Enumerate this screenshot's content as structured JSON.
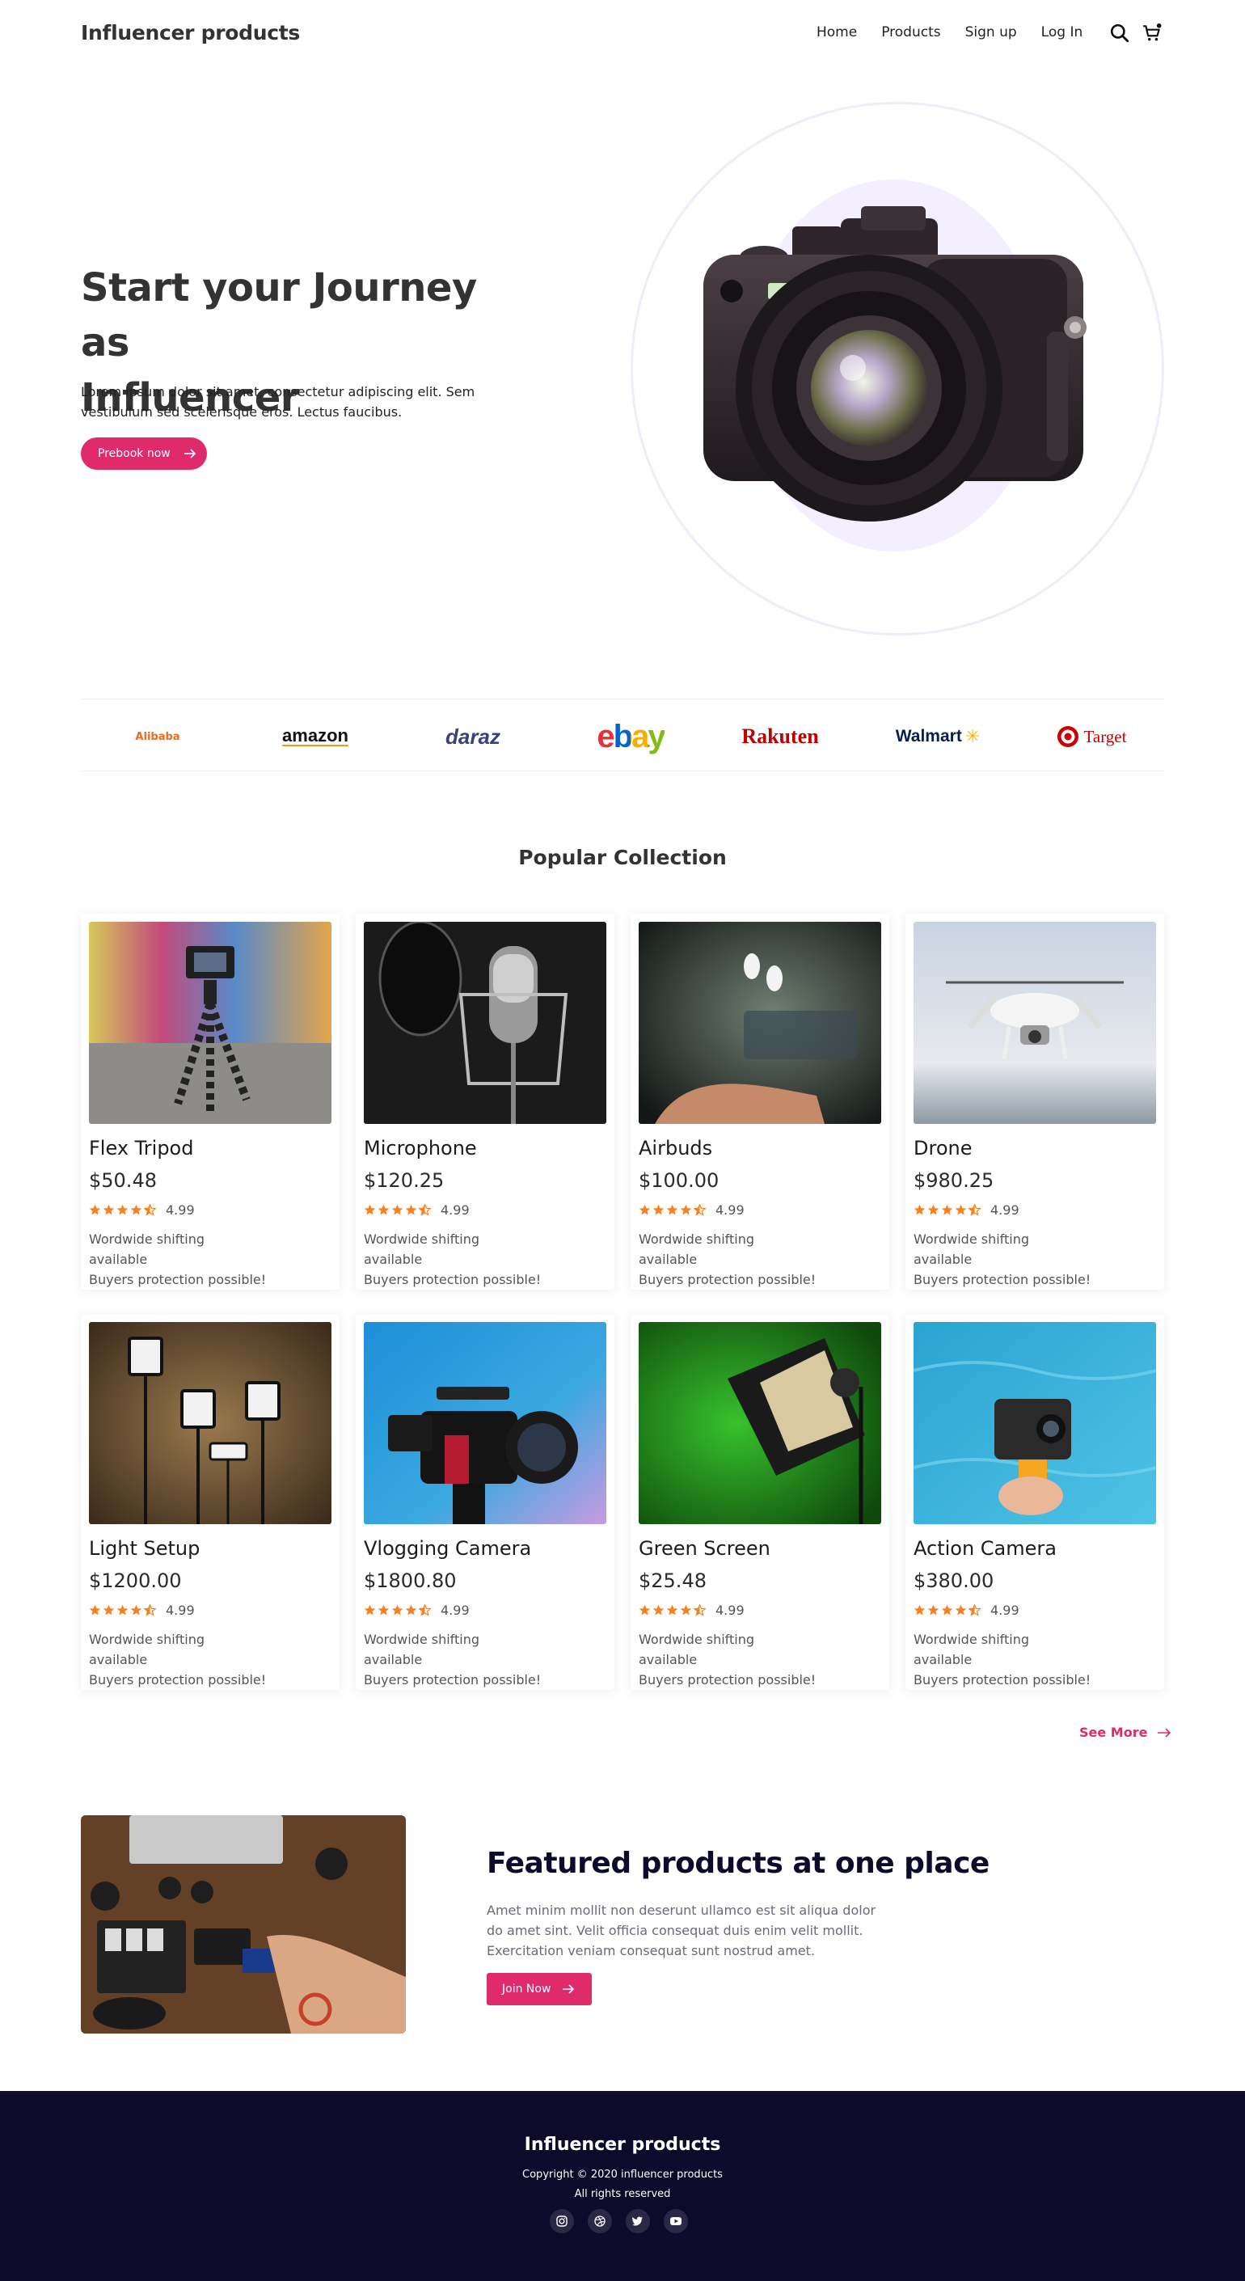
{
  "header": {
    "brand": "Influencer products",
    "nav": [
      "Home",
      "Products",
      "Sign up",
      "Log In"
    ]
  },
  "hero": {
    "title_line1": "Start your Journey as",
    "title_line2": "Influencer",
    "text": "Lorem ipsum dolor sit amet, consectetur adipiscing elit. Sem vestibulum sed scelerisque eros. Lectus faucibus.",
    "button": "Prebook now"
  },
  "logos": [
    "Alibaba",
    "amazon",
    "daraz",
    "ebay",
    "Rakuten",
    "Walmart",
    "Target"
  ],
  "popular": {
    "title": "Popular Collection",
    "products": [
      {
        "name": "Flex Tripod",
        "price": "$50.48",
        "rating": "4.99",
        "line1": "Wordwide shifting",
        "line2": "available",
        "line3": "Buyers protection possible!"
      },
      {
        "name": "Microphone",
        "price": "$120.25",
        "rating": "4.99",
        "line1": "Wordwide shifting",
        "line2": "available",
        "line3": "Buyers protection possible!"
      },
      {
        "name": "Airbuds",
        "price": "$100.00",
        "rating": "4.99",
        "line1": "Wordwide shifting",
        "line2": "available",
        "line3": "Buyers protection possible!"
      },
      {
        "name": "Drone",
        "price": "$980.25",
        "rating": "4.99",
        "line1": "Wordwide shifting",
        "line2": "available",
        "line3": "Buyers protection possible!"
      },
      {
        "name": "Light Setup",
        "price": "$1200.00",
        "rating": "4.99",
        "line1": "Wordwide shifting",
        "line2": "available",
        "line3": "Buyers protection possible!"
      },
      {
        "name": "Vlogging Camera",
        "price": "$1800.80",
        "rating": "4.99",
        "line1": "Wordwide shifting",
        "line2": "available",
        "line3": "Buyers protection possible!"
      },
      {
        "name": "Green Screen",
        "price": "$25.48",
        "rating": "4.99",
        "line1": "Wordwide shifting",
        "line2": "available",
        "line3": "Buyers protection possible!"
      },
      {
        "name": "Action Camera",
        "price": "$380.00",
        "rating": "4.99",
        "line1": "Wordwide shifting",
        "line2": "available",
        "line3": "Buyers protection possible!"
      }
    ],
    "see_more": "See More"
  },
  "featured": {
    "title": "Featured products at one place",
    "text": "Amet minim mollit non deserunt ullamco est sit aliqua dolor do amet sint. Velit officia consequat duis enim velit mollit. Exercitation veniam consequat sunt nostrud amet.",
    "button": "Join Now"
  },
  "footer": {
    "brand": "Influencer products",
    "copyright": "Copyright © 2020 influencer products",
    "rights": "All rights reserved"
  },
  "colors": {
    "accent": "#e02b6a",
    "footer_bg": "#0d0b2b",
    "star": "#f7801f"
  }
}
